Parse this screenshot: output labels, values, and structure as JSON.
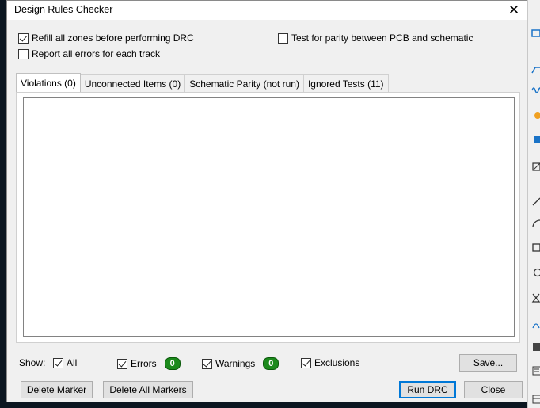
{
  "dialog": {
    "title": "Design Rules Checker",
    "close_glyph": "✕"
  },
  "options": {
    "refill_zones": {
      "label": "Refill all zones before performing DRC",
      "checked": true
    },
    "report_all_errors": {
      "label": "Report all errors for each track",
      "checked": false
    },
    "test_parity": {
      "label": "Test for parity between PCB and schematic",
      "checked": false
    }
  },
  "tabs": [
    {
      "label": "Violations (0)",
      "active": true
    },
    {
      "label": "Unconnected Items (0)",
      "active": false
    },
    {
      "label": "Schematic Parity (not run)",
      "active": false
    },
    {
      "label": "Ignored Tests (11)",
      "active": false
    }
  ],
  "filters": {
    "show_label": "Show:",
    "all": {
      "label": "All",
      "checked": true
    },
    "errors": {
      "label": "Errors",
      "checked": true,
      "count": "0"
    },
    "warnings": {
      "label": "Warnings",
      "checked": true,
      "count": "0"
    },
    "exclusions": {
      "label": "Exclusions",
      "checked": true
    }
  },
  "buttons": {
    "save": "Save...",
    "delete_marker": "Delete Marker",
    "delete_all_markers": "Delete All Markers",
    "run_drc": "Run DRC",
    "close": "Close"
  },
  "colors": {
    "badge_green": "#1c8a1c",
    "toolbar_blue": "#1a73c7",
    "toolbar_orange": "#f0a020"
  }
}
